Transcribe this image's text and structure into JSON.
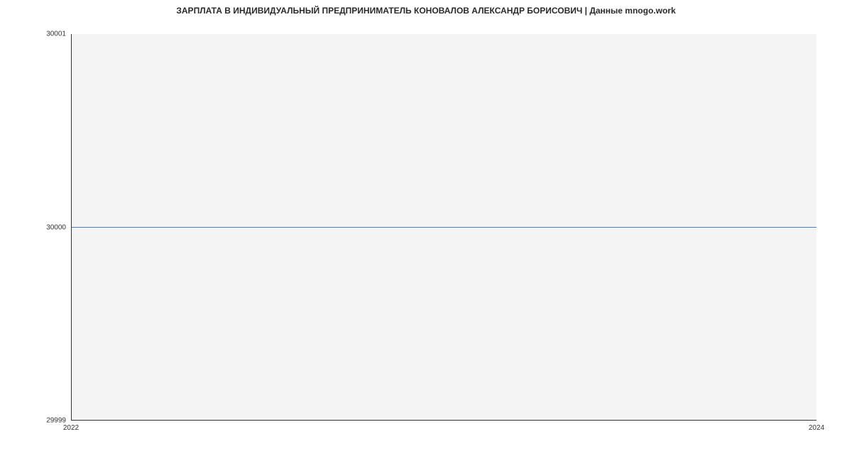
{
  "chart_data": {
    "type": "line",
    "title": "ЗАРПЛАТА В ИНДИВИДУАЛЬНЫЙ ПРЕДПРИНИМАТЕЛЬ КОНОВАЛОВ АЛЕКСАНДР БОРИСОВИЧ | Данные mnogo.work",
    "x": [
      2022,
      2024
    ],
    "values": [
      30000,
      30000
    ],
    "xlabel": "",
    "ylabel": "",
    "xlim": [
      2022,
      2024
    ],
    "ylim": [
      29999,
      30001
    ],
    "x_ticks": [
      2022,
      2024
    ],
    "y_ticks": [
      29999,
      30000,
      30001
    ],
    "line_color": "#4a7fc5"
  }
}
